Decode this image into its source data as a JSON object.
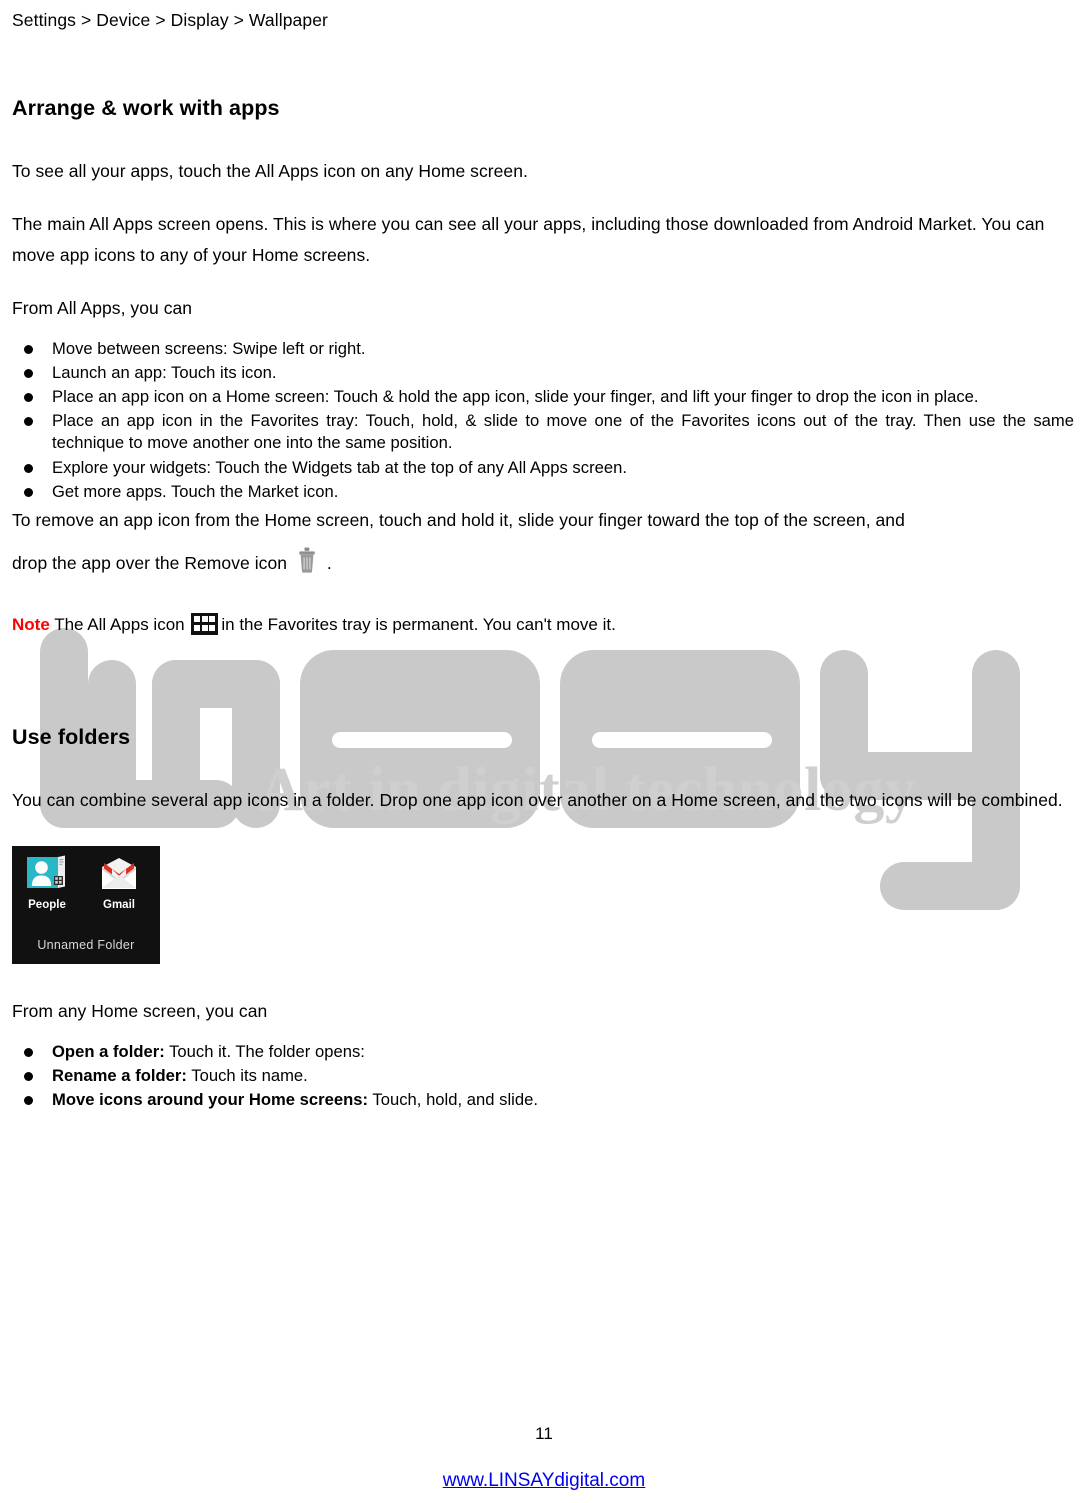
{
  "document": {
    "breadcrumb": "Settings > Device > Display > Wallpaper",
    "page_number": "11",
    "footer_url": "www.LINSAYdigital.com"
  },
  "watermark": {
    "wordmark": "LINSAY",
    "tagline": "Art in digital technology",
    "color": "#c9c9c9"
  },
  "sections": [
    {
      "heading": "Arrange & work with apps",
      "intro": "To see all your apps, touch the All Apps icon on any Home screen.",
      "paragraph2": "The main All Apps screen opens. This is where you can see all your apps, including those downloaded from Android Market. You can move app icons to any of your Home screens.",
      "lead_in": "From All Apps, you can",
      "bullets": [
        "Move between screens: Swipe left or right.",
        "Launch an app: Touch its icon.",
        "Place an app icon on a Home screen: Touch & hold the app icon, slide your finger, and lift your finger to drop the icon in place.",
        "Place an app icon in the Favorites tray: Touch, hold, & slide to move one of the Favorites icons out of the tray. Then use the same technique to move another one into the same position.",
        "Explore your widgets: Touch the Widgets tab at the top of any All Apps screen.",
        "Get more apps. Touch the Market icon."
      ],
      "remove_text_before": "To remove an app icon from the Home screen, touch and hold it, slide your finger toward the top of the screen, and",
      "remove_text_after_a": "drop the app over the Remove icon",
      "remove_text_after_b": ".",
      "note_label": "Note",
      "note_before_icon": "The All Apps icon",
      "note_after_icon": "in the Favorites tray is permanent. You can't move it."
    },
    {
      "heading": "Use folders",
      "paragraph": "You can combine several app icons in a folder. Drop one app icon over another on a Home screen, and the two icons will be combined.",
      "lead_in": "From any Home screen, you can",
      "bullets": [
        {
          "bold": "Open a folder:",
          "rest": " Touch it. The folder opens:"
        },
        {
          "bold": "Rename a folder:",
          "rest": " Touch its name."
        },
        {
          "bold": "Move icons around your Home screens:",
          "rest": " Touch, hold, and slide."
        }
      ]
    }
  ],
  "folder_screenshot": {
    "apps": [
      {
        "name": "People",
        "icon": "people-icon"
      },
      {
        "name": "Gmail",
        "icon": "gmail-icon"
      }
    ],
    "folder_label": "Unnamed Folder"
  },
  "icons": {
    "remove": "trash-icon",
    "all_apps": "all-apps-grid-icon"
  }
}
